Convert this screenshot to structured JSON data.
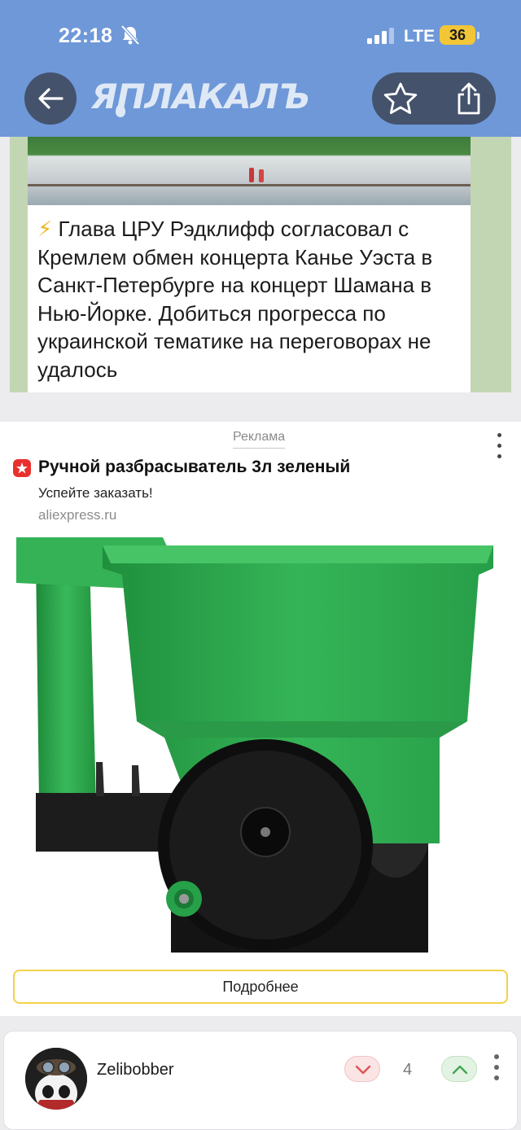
{
  "status_bar": {
    "time": "22:18",
    "network": "LTE",
    "battery": "36"
  },
  "header": {
    "logo_text": "ЯПЛАКАЛЪ",
    "icons": [
      "back-arrow-icon",
      "star-icon",
      "share-icon"
    ]
  },
  "post": {
    "lead_icon": "⚡",
    "text": "Глава ЦРУ Рэдклифф согласовал с Кремлем обмен концерта Канье Уэста в Санкт-Петербурге на концерт Шамана в Нью-Йорке. Добиться прогресса по украинской тематике на переговорах не удалось"
  },
  "ad": {
    "label": "Реклама",
    "title": "Ручной разбрасыватель 3л зеленый",
    "subtitle": "Успейте заказать!",
    "domain": "aliexpress.ru",
    "button_label": "Подробнее"
  },
  "comment": {
    "username": "Zelibobber",
    "votes": "4"
  },
  "colors": {
    "header_bg": "#6e98d8",
    "pill_bg": "#44526c",
    "product_green": "#2eaa4f",
    "button_border": "#f2d24a",
    "battery": "#f3c638"
  }
}
